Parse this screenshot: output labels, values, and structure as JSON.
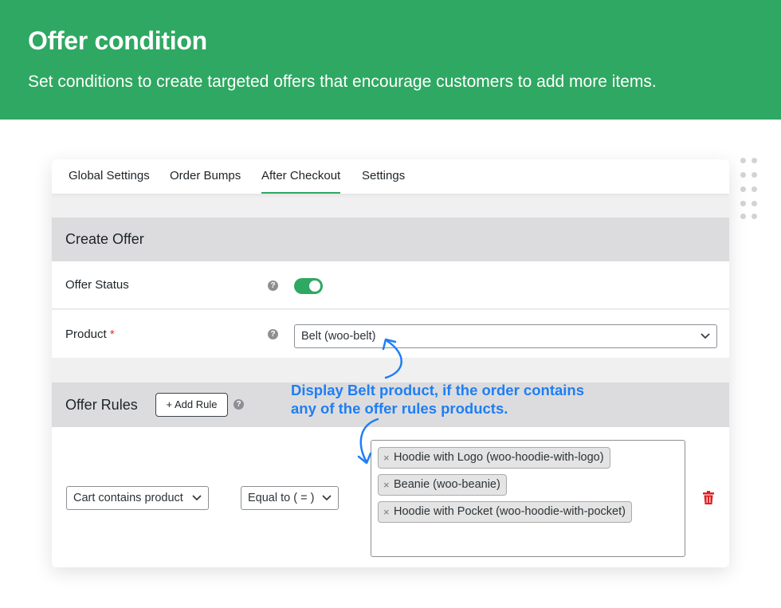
{
  "banner": {
    "title": "Offer condition",
    "subtitle": "Set conditions to create targeted offers that encourage customers to add more items."
  },
  "tabs": [
    {
      "label": "Global Settings",
      "active": false
    },
    {
      "label": "Order Bumps",
      "active": false
    },
    {
      "label": "After Checkout",
      "active": true
    },
    {
      "label": "Settings",
      "active": false
    }
  ],
  "create_offer": {
    "title": "Create Offer",
    "offer_status": {
      "label": "Offer Status",
      "enabled": true
    },
    "product": {
      "label": "Product",
      "required_mark": "*",
      "selected": "Belt (woo-belt)"
    }
  },
  "offer_rules": {
    "title": "Offer Rules",
    "add_rule_label": "+ Add Rule",
    "rule": {
      "condition": "Cart contains product",
      "operator": "Equal to ( = )",
      "products": [
        "Hoodie with Logo (woo-hoodie-with-logo)",
        "Beanie (woo-beanie)",
        "Hoodie with Pocket (woo-hoodie-with-pocket)"
      ],
      "remove_icon": "trash-icon"
    }
  },
  "annotation": {
    "line1": "Display Belt product, if the order contains",
    "line2": "any of the offer rules products."
  },
  "colors": {
    "brand_green": "#2ea862",
    "annotation_blue": "#1e7ef5",
    "delete_red": "#e02020"
  },
  "icons": {
    "help": "question-circle-icon",
    "chip_remove": "×",
    "dropdown": "chevron-down-icon"
  }
}
